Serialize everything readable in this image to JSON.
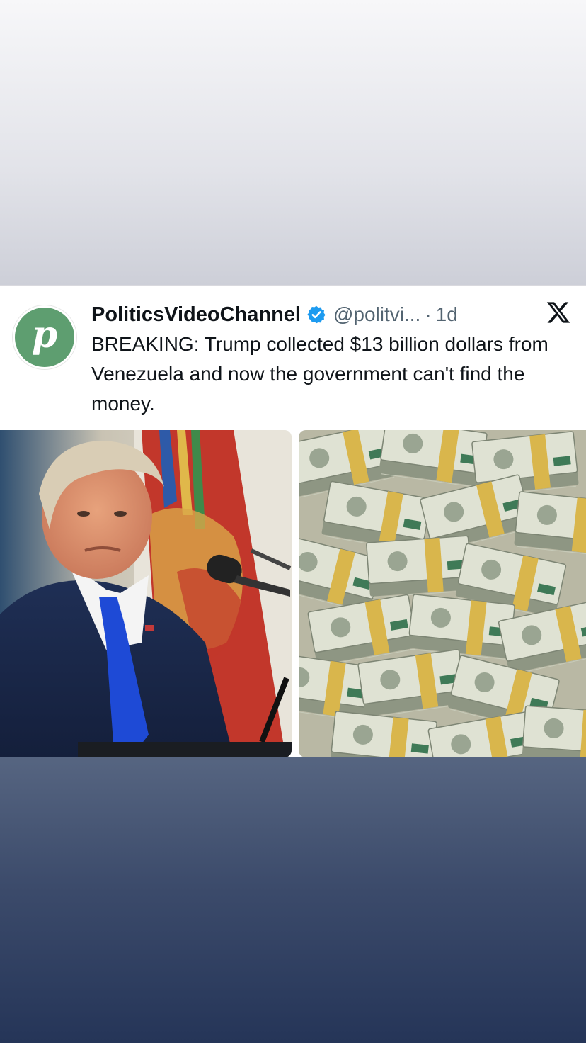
{
  "tweet": {
    "display_name": "PoliticsVideoChannel",
    "handle": "@politvi...",
    "separator": "·",
    "time": "1d",
    "avatar_letter": "p",
    "verified": true,
    "text": "BREAKING: Trump collected $13 billion dollars from Venezuela and now the government can't find the money.",
    "platform_icon": "x-logo-icon",
    "accent_color": "#1d9bf0",
    "avatar_color": "#5e9e70"
  },
  "media": [
    {
      "name": "man-at-podium-photo"
    },
    {
      "name": "money-stacks-photo"
    }
  ]
}
